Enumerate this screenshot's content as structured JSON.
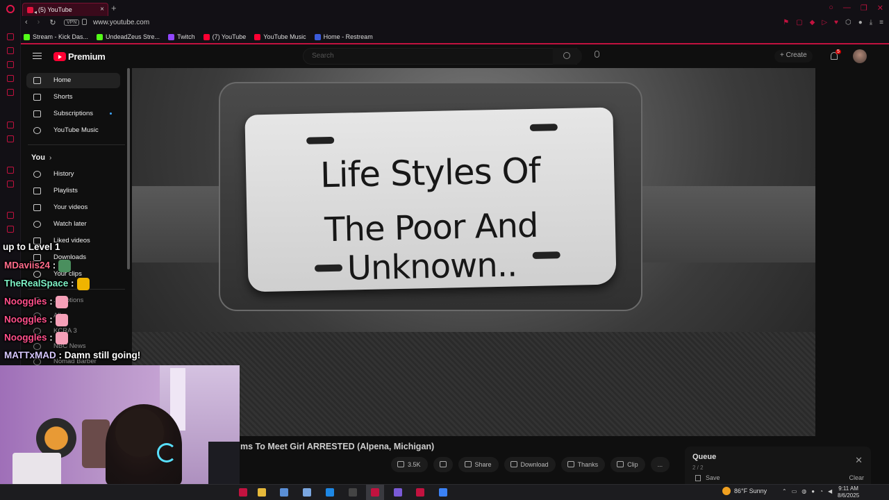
{
  "browser": {
    "tab_title": "(5) YouTube",
    "url": "www.youtube.com",
    "vpn_label": "VPN",
    "bookmarks": [
      {
        "label": "Stream - Kick Das...",
        "color": "#53fc18"
      },
      {
        "label": "UndeadZeus Stre...",
        "color": "#53fc18"
      },
      {
        "label": "Twitch",
        "color": "#9146ff"
      },
      {
        "label": "(7) YouTube",
        "color": "#ff0033"
      },
      {
        "label": "YouTube Music",
        "color": "#ff0033"
      },
      {
        "label": "Home - Restream",
        "color": "#3b5bdb"
      }
    ],
    "accent_color": "#c2123f"
  },
  "youtube": {
    "logo_text": "Premium",
    "search_placeholder": "Search",
    "create_label": "Create",
    "notification_count": "5",
    "sidebar": {
      "main_items": [
        {
          "label": "Home",
          "icon": "home-icon",
          "active": true
        },
        {
          "label": "Shorts",
          "icon": "shorts-icon"
        },
        {
          "label": "Subscriptions",
          "icon": "subscriptions-icon"
        },
        {
          "label": "YouTube Music",
          "icon": "youtube-music-icon"
        }
      ],
      "you_heading": "You",
      "you_items": [
        {
          "label": "History",
          "icon": "history-icon"
        },
        {
          "label": "Playlists",
          "icon": "playlists-icon"
        },
        {
          "label": "Your videos",
          "icon": "your-videos-icon"
        },
        {
          "label": "Watch later",
          "icon": "watch-later-icon"
        },
        {
          "label": "Liked videos",
          "icon": "liked-videos-icon"
        },
        {
          "label": "Downloads",
          "icon": "downloads-icon"
        },
        {
          "label": "Your clips",
          "icon": "clips-icon"
        }
      ],
      "subscriptions_partial": [
        "...criptions",
        "All",
        "KCRA 3",
        "NBC News",
        "Nomad Barber"
      ]
    },
    "video": {
      "plate_line_1": "Life Styles Of",
      "plate_line_2": "The Poor And Unknown..",
      "title_visible": "ms To Meet Girl ARRESTED (Alpena, Michigan)",
      "actions": {
        "likes": "3.5K",
        "share": "Share",
        "download": "Download",
        "thanks": "Thanks",
        "clip": "Clip",
        "more": "..."
      }
    },
    "queue": {
      "title": "Queue",
      "count": "2 / 2",
      "save": "Save",
      "clear": "Clear"
    }
  },
  "chat_overlay": {
    "system_line": "up to Level 1",
    "messages": [
      {
        "user": "MDaviis24",
        "sep": " :",
        "text": "",
        "color": "#ff6b8a",
        "emote": "#4a8f5e"
      },
      {
        "user": "TheRealSpace",
        "sep": " :",
        "text": "",
        "color": "#7cf0c4",
        "emote": "#f0b400"
      },
      {
        "user": "Nooggles",
        "sep": " :",
        "text": "",
        "color": "#ff4f8a",
        "emote": "#f5a0b8"
      },
      {
        "user": "Nooggles",
        "sep": " :",
        "text": "",
        "color": "#ff4f8a",
        "emote": "#f5a0b8"
      },
      {
        "user": "Nooggles",
        "sep": " :",
        "text": "",
        "color": "#ff4f8a",
        "emote": "#f5a0b8"
      },
      {
        "user": "MATTxMAD",
        "sep": " :",
        "text": " Damn still going!",
        "color": "#d8c9ff",
        "emote": ""
      }
    ]
  },
  "taskbar": {
    "weather": "86°F  Sunny",
    "time": "9:11 AM",
    "date": "8/6/2025"
  }
}
